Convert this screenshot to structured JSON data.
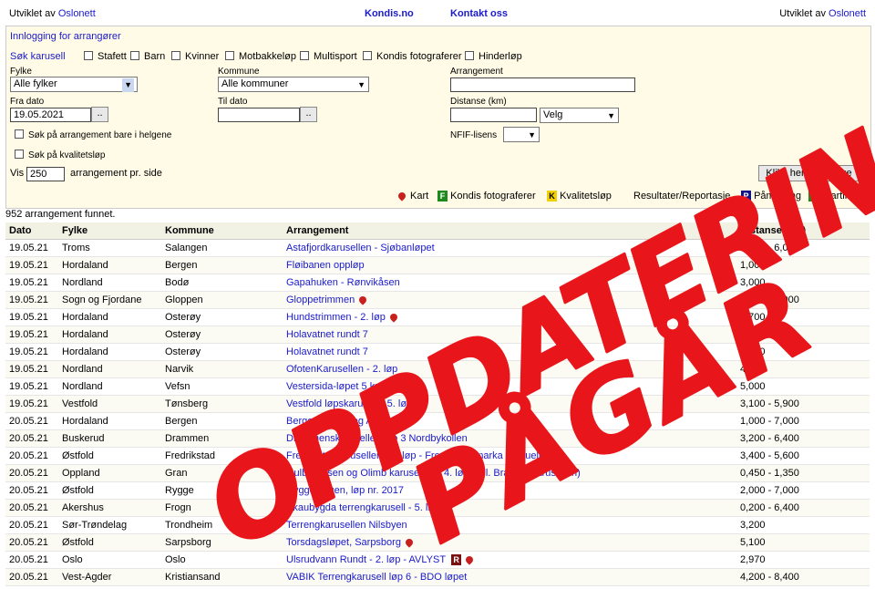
{
  "header": {
    "left_prefix": "Utviklet av",
    "left_link": "Oslonett",
    "center_link1": "Kondis.no",
    "center_link2": "Kontakt oss",
    "right_prefix": "Utviklet av",
    "right_link": "Oslonett"
  },
  "search": {
    "login_link": "Innlogging for arrangører",
    "search_label": "Søk karusell",
    "categories": [
      "Stafett",
      "Barn",
      "Kvinner",
      "Motbakkeløp",
      "Multisport",
      "Kondis fotograferer",
      "Hinderløp"
    ],
    "fylke_label": "Fylke",
    "fylke_value": "Alle fylker",
    "kommune_label": "Kommune",
    "kommune_value": "Alle kommuner",
    "arrangement_label": "Arrangement",
    "fra_dato_label": "Fra dato",
    "fra_dato_value": "19.05.2021",
    "til_dato_label": "Til dato",
    "til_dato_value": "",
    "distanse_label": "Distanse (km)",
    "distanse_select": "Velg",
    "helg_label": "Søk på arrangement bare i helgene",
    "kvalitet_label": "Søk på kvalitetsløp",
    "nfif_label": "NFIF-lisens",
    "vis_label": "Vis",
    "vis_value": "250",
    "per_side_label": "arrangement pr. side",
    "search_button": "Klikk her for å søke",
    "date_picker_button": ".."
  },
  "legend": {
    "kart": "Kart",
    "kondis_fotograferer": "Kondis fotograferer",
    "kvalitetslop": "Kvalitetsløp",
    "resultater": "Resultater/Reportasje",
    "pamelding": "Påmelding",
    "startliste": "Startliste",
    "badge_k": "K",
    "badge_p": "P",
    "badge_s": "S",
    "badge_f": "F"
  },
  "results_count": "952 arrangement funnet.",
  "table": {
    "headers": [
      "Dato",
      "Fylke",
      "Kommune",
      "Arrangement",
      "Distanse (km)"
    ],
    "rows": [
      [
        "19.05.21",
        "Troms",
        "Salangen",
        "Astafjordkarusellen - Sjøbanløpet",
        "1,000 - 6,000"
      ],
      [
        "19.05.21",
        "Hordaland",
        "Bergen",
        "Fløibanen oppløp",
        "1,000"
      ],
      [
        "19.05.21",
        "Nordland",
        "Bodø",
        "Gapahuken - Rønvikåsen",
        "3,000"
      ],
      [
        "19.05.21",
        "Sogn og Fjordane",
        "Gloppen",
        "Gloppetrimmen",
        "2,000 - 4,000"
      ],
      [
        "19.05.21",
        "Hordaland",
        "Osterøy",
        "Hundstrimmen - 2. løp",
        "3,700"
      ],
      [
        "19.05.21",
        "Hordaland",
        "Osterøy",
        "Holavatnet rundt 7",
        "3,100"
      ],
      [
        "19.05.21",
        "Hordaland",
        "Osterøy",
        "Holavatnet rundt 7",
        "3,100"
      ],
      [
        "19.05.21",
        "Nordland",
        "Narvik",
        "OfotenKarusellen - 2. løp",
        "4,000"
      ],
      [
        "19.05.21",
        "Nordland",
        "Vefsn",
        "Vestersida-løpet 5 km",
        "5,000"
      ],
      [
        "19.05.21",
        "Vestfold",
        "Tønsberg",
        "Vestfold løpskarusell - 5. løp",
        "3,100 - 5,900"
      ],
      [
        "20.05.21",
        "Hordaland",
        "Bergen",
        "Bergens Råesteg AVLYST",
        "1,000 - 7,000"
      ],
      [
        "20.05.21",
        "Buskerud",
        "Drammen",
        "Drammenskarusellen løp 3 Nordbykollen",
        "3,200 - 6,400"
      ],
      [
        "20.05.21",
        "Østfold",
        "Fredrikstad",
        "Fredrikstadkarusellen - 1. løp - Fredrikstadmarka - virtuelt",
        "3,400 - 5,600"
      ],
      [
        "20.05.21",
        "Oppland",
        "Gran",
        "Gulbrandsen og Olimb karusellen - 4. løp (tidl. Brandbukarusellen)",
        "0,450 - 1,350"
      ],
      [
        "20.05.21",
        "Østfold",
        "Rygge",
        "Ryggejoggen, løp nr. 2017",
        "2,000 - 7,000"
      ],
      [
        "20.05.21",
        "Akershus",
        "Frogn",
        "Skaubygda terrengkarusell - 5. løp",
        "0,200 - 6,400"
      ],
      [
        "20.05.21",
        "Sør-Trøndelag",
        "Trondheim",
        "Terrengkarusellen Nilsbyen",
        "3,200"
      ],
      [
        "20.05.21",
        "Østfold",
        "Sarpsborg",
        "Torsdagsløpet, Sarpsborg",
        "5,100"
      ],
      [
        "20.05.21",
        "Oslo",
        "Oslo",
        "Ulsrudvann Rundt - 2. løp - AVLYST",
        "2,970"
      ],
      [
        "20.05.21",
        "Vest-Agder",
        "Kristiansand",
        "VABIK Terrengkarusell løp 6 - BDO løpet",
        "4,200 - 8,400"
      ]
    ],
    "row_icons": {
      "3": "pin",
      "4": "pin",
      "6": "badge7",
      "17": "pin",
      "18": "r-pin"
    },
    "r_badge": "R"
  },
  "overlay": {
    "line1": "OPPDATERING",
    "line2": "PÅGÅR",
    "color": "#e8161b"
  }
}
